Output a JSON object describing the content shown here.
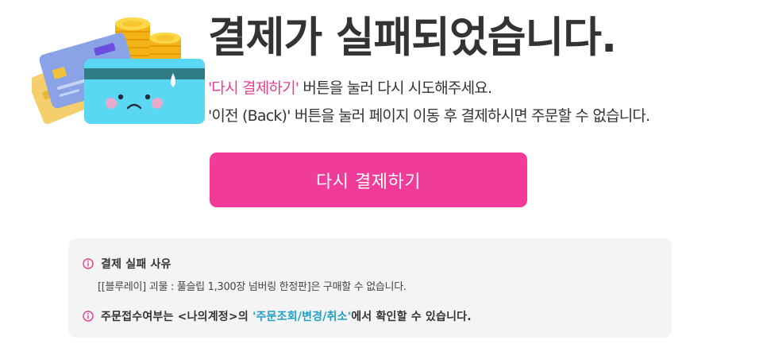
{
  "main": {
    "title": "결제가 실패되었습니다.",
    "desc_line1_quoted": "'다시 결제하기'",
    "desc_line1_rest": " 버튼을 눌러 다시 시도해주세요.",
    "desc_line2": "'이전 (Back)' 버튼을 눌러 페이지 이동 후 결제하시면 주문할 수 없습니다.",
    "retry_button_label": "다시 결제하기"
  },
  "info": {
    "reason_title": "결제 실패 사유",
    "reason_text": "[[블루레이] 괴물 : 풀슬립 1,300장 넘버링 한정판]은 구매할 수 없습니다.",
    "notice_prefix": "주문접수여부는 <나의계정>의 ",
    "notice_link": "'주문조회/변경/취소'",
    "notice_suffix": "에서 확인할 수 있습니다."
  },
  "icons": {
    "illustration": "sad-credit-card-with-coins-icon",
    "info": "info-circle-icon"
  },
  "colors": {
    "accent_pink": "#f03b98",
    "pink_text": "#ea3b8f",
    "link_blue": "#1fa0c7",
    "box_bg": "#f4f4f4"
  }
}
